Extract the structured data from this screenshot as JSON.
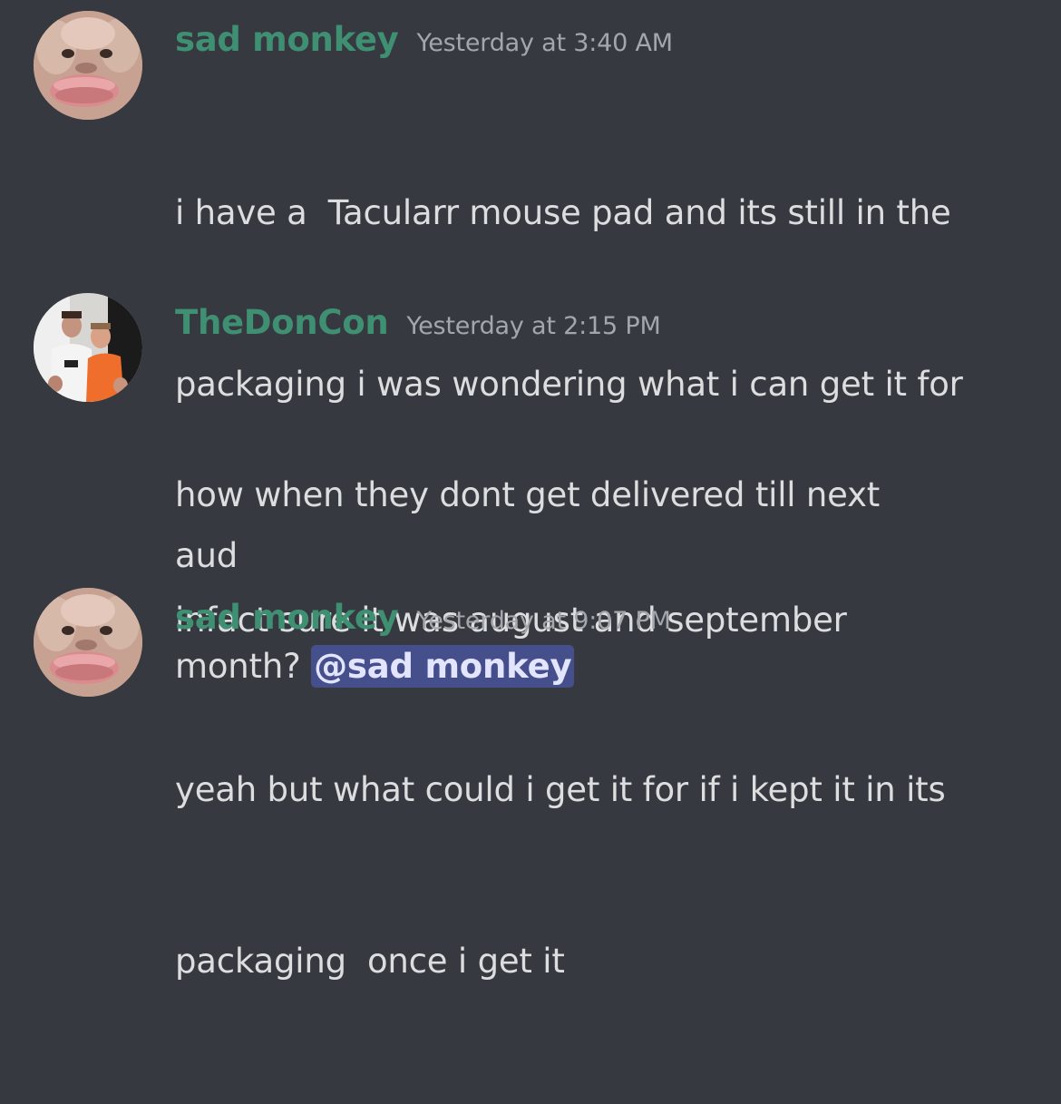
{
  "colors": {
    "background": "#36393f",
    "username": "#3f8f73",
    "message_text": "#dcddde",
    "timestamp": "#a3a6aa",
    "mention_bg": "#454f8c",
    "mention_text": "#e3e5ff"
  },
  "messages": [
    {
      "author": "sad monkey",
      "timestamp": "Yesterday at 3:40 AM",
      "avatar": "monkey-avatar",
      "lines": [
        "i have a  Tacularr mouse pad and its still in the",
        "packaging i was wondering what i can get it for",
        "aud"
      ]
    },
    {
      "author": "TheDonCon",
      "timestamp": "Yesterday at 2:15 PM",
      "avatar": "two-men-photo-avatar",
      "lines": [
        "how when they dont get delivered till next",
        "month? "
      ],
      "mention": "@sad monkey",
      "followup": "infact sure it was august and september"
    },
    {
      "author": "sad monkey",
      "timestamp": "Yesterday at 9:07 PM",
      "avatar": "monkey-avatar",
      "lines": [
        "yeah but what could i get it for if i kept it in its",
        "packaging  once i get it"
      ]
    }
  ]
}
